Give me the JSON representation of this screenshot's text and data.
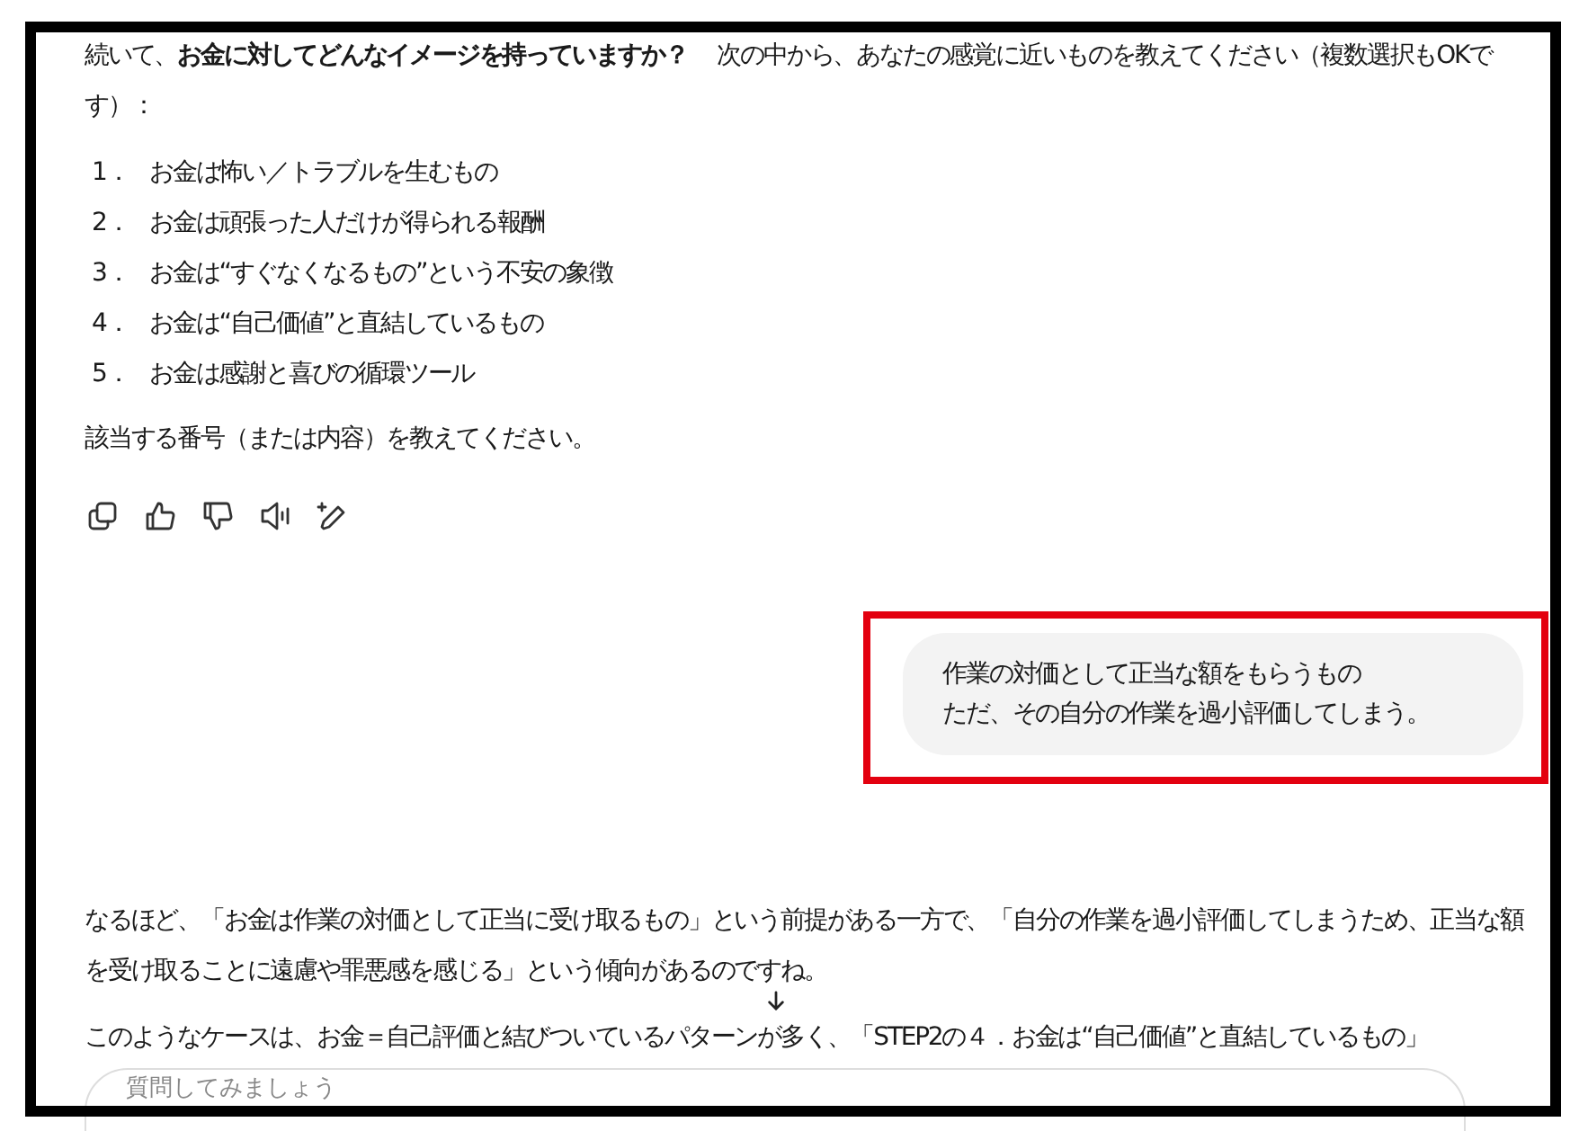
{
  "prompt": {
    "intro": "続いて、**お金に対してどんなイメージを持っていますか？**　 次の中から、あなたの感覚に近いものを教えてください（複数選択もOKです）：",
    "options": [
      {
        "number": "1．",
        "text": "お金は怖い／トラブルを生むもの"
      },
      {
        "number": "2．",
        "text": "お金は頑張った人だけが得られる報酬"
      },
      {
        "number": "3．",
        "text": "お金は“すぐなくなるもの”という不安の象徴"
      },
      {
        "number": "4．",
        "text": "お金は“自己価値”と直結しているもの"
      },
      {
        "number": "5．",
        "text": "お金は感謝と喜びの循環ツール"
      }
    ],
    "closing": "該当する番号（または内容）を教えてください。"
  },
  "message_actions": [
    {
      "kind": "copy"
    },
    {
      "kind": "like"
    },
    {
      "kind": "dislike"
    },
    {
      "kind": "read_aloud"
    },
    {
      "kind": "edit"
    }
  ],
  "user_message": {
    "highlighted": true,
    "lines": [
      "作業の対価として正当な額をもらうもの",
      "ただ、その自分の作業を過小評価してしまう。"
    ]
  },
  "reply": {
    "paragraphs": [
      "なるほど、「お金は作業の対価として正当に受け取るもの」という前提がある一方で、「自分の作業を過小評価してしまうため、正当な額を受け取ることに遠慮や罪悪感を感じる」という傾向があるのですね。",
      "このようなケースは、お金＝自己評価と結びついているパターンが多く、「STEP2の４．お金は“自己価値”と直結しているもの」"
    ]
  },
  "composer": {
    "placeholder": "質問してみましょう"
  }
}
